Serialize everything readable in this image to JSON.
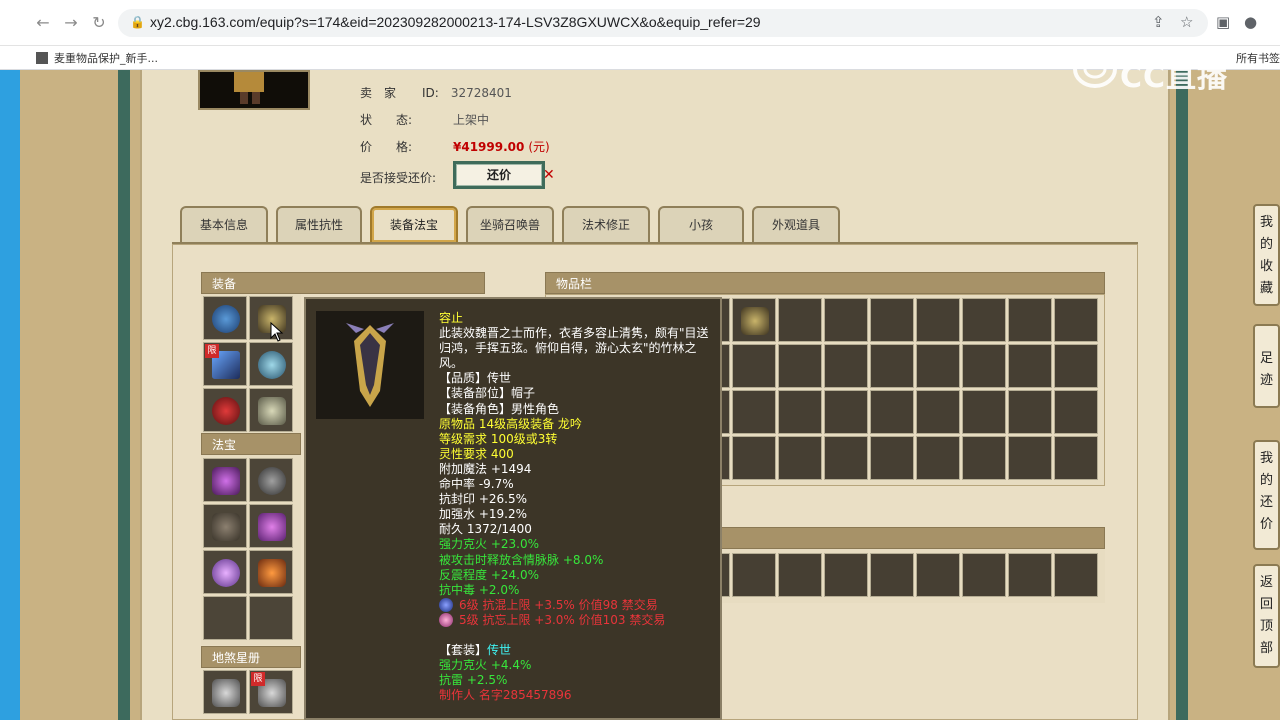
{
  "browser": {
    "url": "xy2.cbg.163.com/equip?s=174&eid=202309282000213-174-LSV3Z8GXUWCX&o&equip_refer=29",
    "bookmark": "麦重物品保护_新手...",
    "bookmark_right": "所有书签"
  },
  "watermark": {
    "text": "CC直播"
  },
  "item": {
    "seller_label": "卖　家",
    "id_label": "ID:",
    "seller_id": "32728401",
    "status_label": "状　　态:",
    "status": "上架中",
    "price_label": "价　　格:",
    "price": "¥41999.00",
    "price_unit": "(元)",
    "counter_label": "是否接受还价:",
    "counter_button": "还价"
  },
  "tabs": [
    "基本信息",
    "属性抗性",
    "装备法宝",
    "坐骑召唤兽",
    "法术修正",
    "小孩",
    "外观道具"
  ],
  "active_tab": 2,
  "sections": {
    "equipment": "装备",
    "magic": "法宝",
    "earth": "地煞星册",
    "inventory": "物品栏",
    "limit_badge": "限"
  },
  "tooltip": {
    "name": "容止",
    "desc": "此装效魏晋之士而作，衣者多容止清隽，颇有\"目送归鸿，手挥五弦。俯仰自得，游心太玄\"的竹林之风。",
    "quality": "【品质】传世",
    "slot": "【装备部位】帽子",
    "role": "【装备角色】男性角色",
    "origin": "原物品 14级高级装备 龙吟",
    "level_req": "等级需求 100级或3转",
    "spirit_req": "灵性要求 400",
    "stats_white": [
      "附加魔法 +1494",
      "命中率 -9.7%",
      "抗封印 +26.5%",
      "加强水 +19.2%",
      "耐久 1372/1400"
    ],
    "stats_green": [
      "强力克火 +23.0%",
      "被攻击时释放含情脉脉 +8.0%",
      "反震程度 +24.0%",
      "抗中毒 +2.0%"
    ],
    "gems": [
      "6级 抗混上限 +3.5% 价值98 禁交易",
      "5级 抗忘上限 +3.0% 价值103 禁交易"
    ],
    "set_label": "【套装】",
    "set_name": "传世",
    "set_stats": [
      "强力克火 +4.4%",
      "抗雷 +2.5%"
    ],
    "maker": "制作人 名字285457896"
  },
  "side_nav": [
    "我的收藏",
    "足迹",
    "我的还价",
    "返回顶部"
  ],
  "colors": {
    "frame": "#3d6a5d",
    "panel": "#e9dfc4",
    "section_header": "#a79268",
    "cell": "#4c4538",
    "tooltip_bg": "#3c3527",
    "price_red": "#c00000"
  },
  "icons": {
    "back": "arrow-left-icon",
    "forward": "arrow-right-icon",
    "reload": "reload-icon",
    "lock": "lock-icon",
    "share": "share-icon",
    "star": "star-icon",
    "window": "window-icon",
    "profile": "profile-icon"
  }
}
